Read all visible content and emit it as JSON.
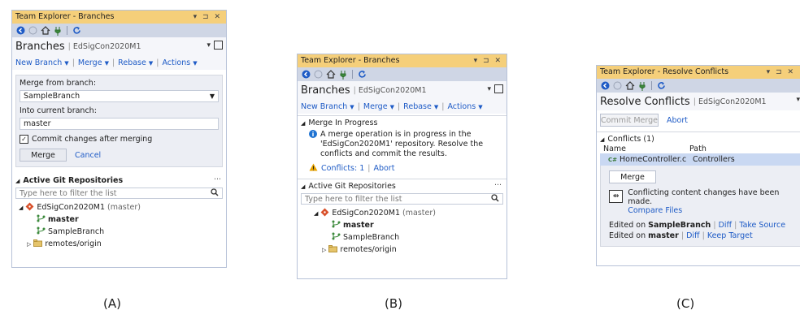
{
  "panel_a": {
    "title": "Team Explorer - Branches",
    "window_controls": "▾ ᛫ ✕",
    "heading": "Branches",
    "repo": "EdSigCon2020M1",
    "actions": [
      "New Branch",
      "Merge",
      "Rebase",
      "Actions"
    ],
    "merge_from_label": "Merge from branch:",
    "merge_from_value": "SampleBranch",
    "into_label": "Into current branch:",
    "into_value": "master",
    "commit_checkbox_label": "Commit changes after merging",
    "merge_button": "Merge",
    "cancel_link": "Cancel",
    "active_repos_header": "Active Git Repositories",
    "filter_placeholder": "Type here to filter the list",
    "repo_node": "EdSigCon2020M1",
    "repo_node_branch": "(master)",
    "branch_master": "master",
    "branch_sample": "SampleBranch",
    "remotes": "remotes/origin"
  },
  "panel_b": {
    "title": "Team Explorer - Branches",
    "heading": "Branches",
    "repo": "EdSigCon2020M1",
    "actions": [
      "New Branch",
      "Merge",
      "Rebase",
      "Actions"
    ],
    "merge_progress_header": "Merge In Progress",
    "merge_message": "A merge operation is in progress in the 'EdSigCon2020M1' repository. Resolve the conflicts and commit the results.",
    "conflicts_link": "Conflicts: 1",
    "abort_link": "Abort",
    "active_repos_header": "Active Git Repositories",
    "filter_placeholder": "Type here to filter the list",
    "repo_node": "EdSigCon2020M1",
    "repo_node_branch": "(master)",
    "branch_master": "master",
    "branch_sample": "SampleBranch",
    "remotes": "remotes/origin"
  },
  "panel_c": {
    "title": "Team Explorer - Resolve Conflicts",
    "heading": "Resolve Conflicts",
    "repo": "EdSigCon2020M1",
    "commit_merge_button": "Commit Merge",
    "abort_link": "Abort",
    "conflicts_header": "Conflicts (1)",
    "col_name": "Name",
    "col_path": "Path",
    "conflict_file": "HomeController.cs [b...",
    "conflict_path": "Controllers",
    "merge_button": "Merge",
    "conflict_message": "Conflicting content changes have been made.",
    "compare_files_link": "Compare Files",
    "edited_on_prefix": "Edited on",
    "source_branch": "SampleBranch",
    "target_branch": "master",
    "diff_link": "Diff",
    "take_source_link": "Take Source",
    "keep_target_link": "Keep Target"
  },
  "captions": {
    "a": "(A)",
    "b": "(B)",
    "c": "(C)"
  },
  "colors": {
    "title_bar": "#f5cf7a",
    "toolbar": "#cfd6e5",
    "link": "#1e5bc6",
    "selected_row": "#c9d8f2",
    "warning": "#e8a400",
    "info": "#1e73d2",
    "repo_icon": "#d8502a"
  }
}
